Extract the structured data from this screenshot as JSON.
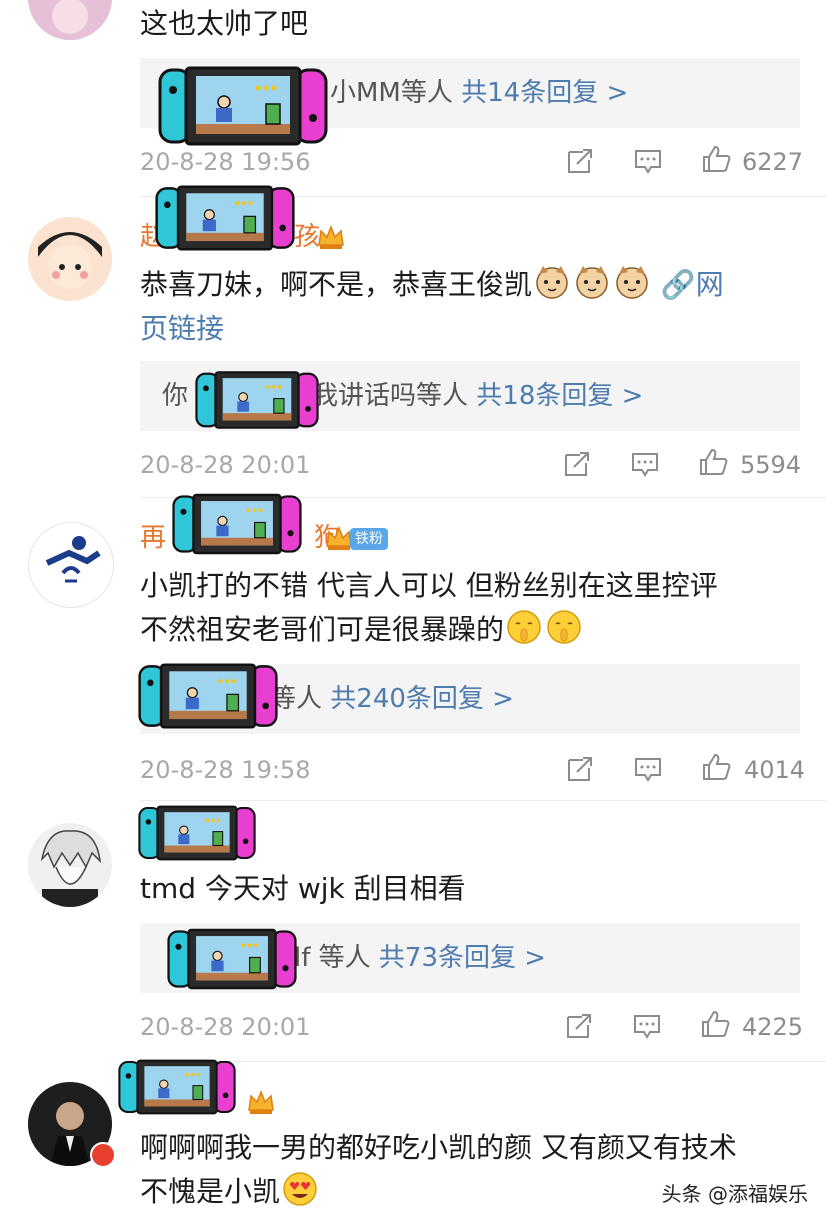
{
  "comments": [
    {
      "name_prefix": "",
      "name_suffix": "",
      "text": "这也太帅了吧",
      "link": "",
      "reply_prefix": "",
      "reply_suffix": "小MM等人",
      "reply_count": "共14条回复 >",
      "time": "20-8-28 19:56",
      "likes": "6227"
    },
    {
      "name_prefix": "赵",
      "name_suffix": "孩",
      "text": "恭喜刀妹，啊不是，恭喜王俊凯",
      "link": "网",
      "link_cont": "页链接",
      "reply_prefix": "你",
      "reply_suffix": "我讲话吗等人",
      "reply_count": "共18条回复 >",
      "time": "20-8-28 20:01",
      "likes": "5594"
    },
    {
      "name_prefix": "再",
      "name_suffix": "狗",
      "badge": "铁粉",
      "text_line1": "小凯打的不错 代言人可以 但粉丝别在这里控评",
      "text_line2": "不然祖安老哥们可是很暴躁的",
      "reply_prefix": "",
      "reply_suffix": "等人",
      "reply_count": "共240条回复 >",
      "time": "20-8-28 19:58",
      "likes": "4014"
    },
    {
      "name_prefix": "",
      "name_suffix": "",
      "text": "tmd 今天对 wjk 刮目相看",
      "reply_prefix": "",
      "reply_suffix": "lf 等人",
      "reply_count": "共73条回复 >",
      "time": "20-8-28 20:01",
      "likes": "4225"
    },
    {
      "name_prefix": "",
      "name_suffix": "",
      "text_line1": "啊啊啊我一男的都好吃小凯的颜 又有颜又有技术",
      "text_line2": "不愧是小凯"
    }
  ],
  "watermark": "头条 @添福娱乐",
  "colors": {
    "name": "#e8772e",
    "link": "#4f7cae",
    "reply_bg": "#f4f4f4",
    "meta": "#a8a8a8"
  },
  "icons": [
    "repost-icon",
    "comment-icon",
    "like-icon",
    "crown-icon",
    "switch-sticker"
  ]
}
